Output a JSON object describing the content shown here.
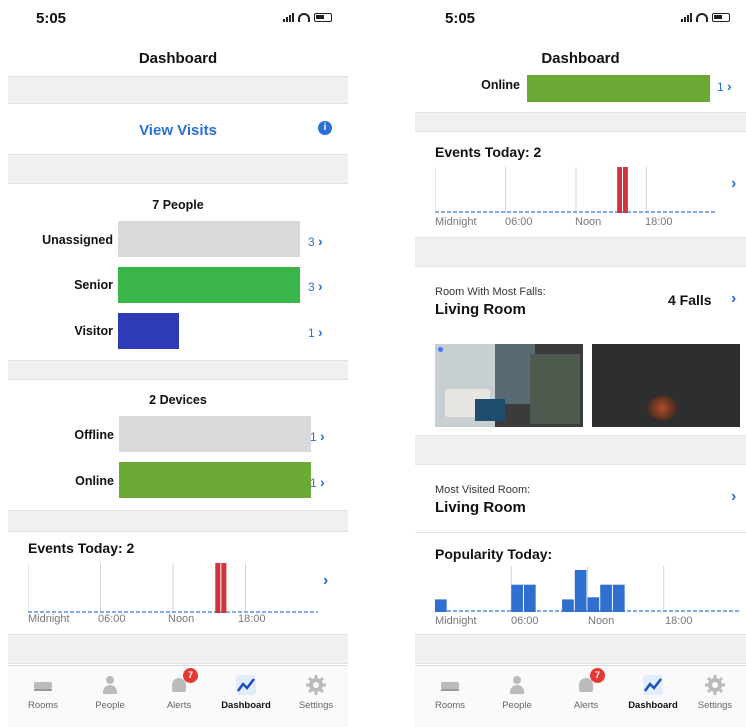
{
  "status": {
    "time": "5:05"
  },
  "nav": {
    "title": "Dashboard"
  },
  "left": {
    "view_visits": "View Visits",
    "people": {
      "title": "7 People",
      "rows": [
        {
          "label": "Unassigned",
          "count": "3",
          "value": 3,
          "color": "#d9d9d9"
        },
        {
          "label": "Senior",
          "count": "3",
          "value": 3,
          "color": "#3ab54a"
        },
        {
          "label": "Visitor",
          "count": "1",
          "value": 1,
          "color": "#2e3bb5"
        }
      ]
    },
    "devices": {
      "title": "2 Devices",
      "rows": [
        {
          "label": "Offline",
          "count": "1",
          "value": 1,
          "color": "#d9d9d9"
        },
        {
          "label": "Online",
          "count": "1",
          "value": 1,
          "color": "#6aaa35"
        }
      ]
    },
    "events": {
      "title": "Events Today: 2"
    }
  },
  "right": {
    "online_label": "Online",
    "online_count": "1",
    "events": {
      "title": "Events Today: 2"
    },
    "falls": {
      "caption": "Room With Most Falls:",
      "room": "Living Room",
      "count": "4 Falls"
    },
    "visited": {
      "caption": "Most Visited Room:",
      "room": "Living Room"
    },
    "popularity": {
      "title": "Popularity Today:"
    }
  },
  "chart_data": [
    {
      "type": "bar",
      "title": "Events Today: 2",
      "x_tick_labels": [
        "Midnight",
        "06:00",
        "Noon",
        "18:00"
      ],
      "x_range_hours": [
        0,
        24
      ],
      "bins": [
        {
          "hour_start": 15.5,
          "hour_end": 16.0,
          "value": 1
        },
        {
          "hour_start": 16.0,
          "hour_end": 16.5,
          "value": 1
        }
      ],
      "bar_color": "#d0333a"
    },
    {
      "type": "bar",
      "title": "Popularity Today:",
      "x_tick_labels": [
        "Midnight",
        "06:00",
        "Noon",
        "18:00"
      ],
      "x_range_hours": [
        0,
        24
      ],
      "values_hourly": [
        0.3,
        0,
        0,
        0,
        0,
        0,
        0.65,
        0.65,
        0,
        0,
        0.3,
        1.0,
        0.35,
        0.65,
        0.65,
        0,
        0,
        0,
        0,
        0,
        0,
        0,
        0,
        0
      ],
      "bar_color": "#2f6fd0"
    }
  ],
  "tabs": [
    {
      "label": "Rooms",
      "icon": "bed-icon"
    },
    {
      "label": "People",
      "icon": "person-icon"
    },
    {
      "label": "Alerts",
      "icon": "bell-icon",
      "badge": "7"
    },
    {
      "label": "Dashboard",
      "icon": "chart-line-icon",
      "active": true
    },
    {
      "label": "Settings",
      "icon": "gear-icon"
    }
  ]
}
